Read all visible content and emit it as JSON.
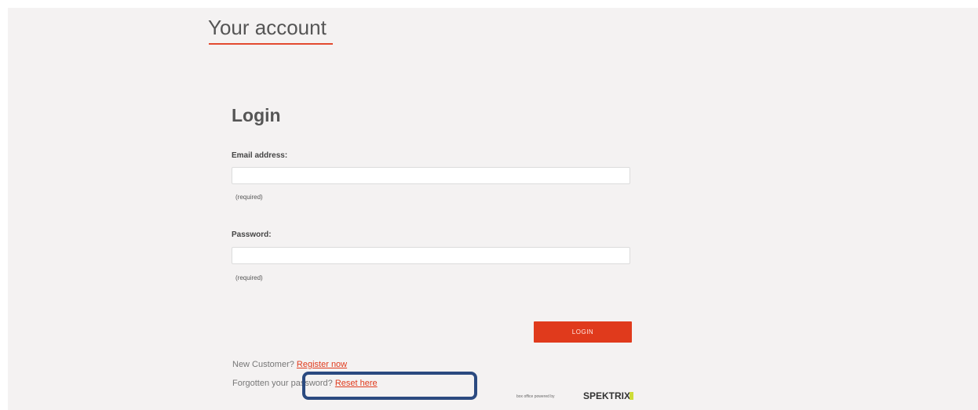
{
  "header": {
    "title": "Your account"
  },
  "login": {
    "heading": "Login",
    "email": {
      "label": "Email address:",
      "value": "",
      "placeholder": "",
      "required_note": "(required)"
    },
    "password": {
      "label": "Password:",
      "value": "",
      "placeholder": "",
      "required_note": "(required)"
    },
    "submit_label": "LOGIN"
  },
  "footer": {
    "new_customer_text": "New Customer?",
    "register_link": "Register now",
    "forgot_text": "Forgotten your password?",
    "reset_link": "Reset here",
    "powered_text": "box office powered by",
    "brand": "SPEKTRIX"
  },
  "colors": {
    "accent": "#e03a1c",
    "highlight_border": "#2b4a80",
    "background": "#f4f2f2"
  }
}
